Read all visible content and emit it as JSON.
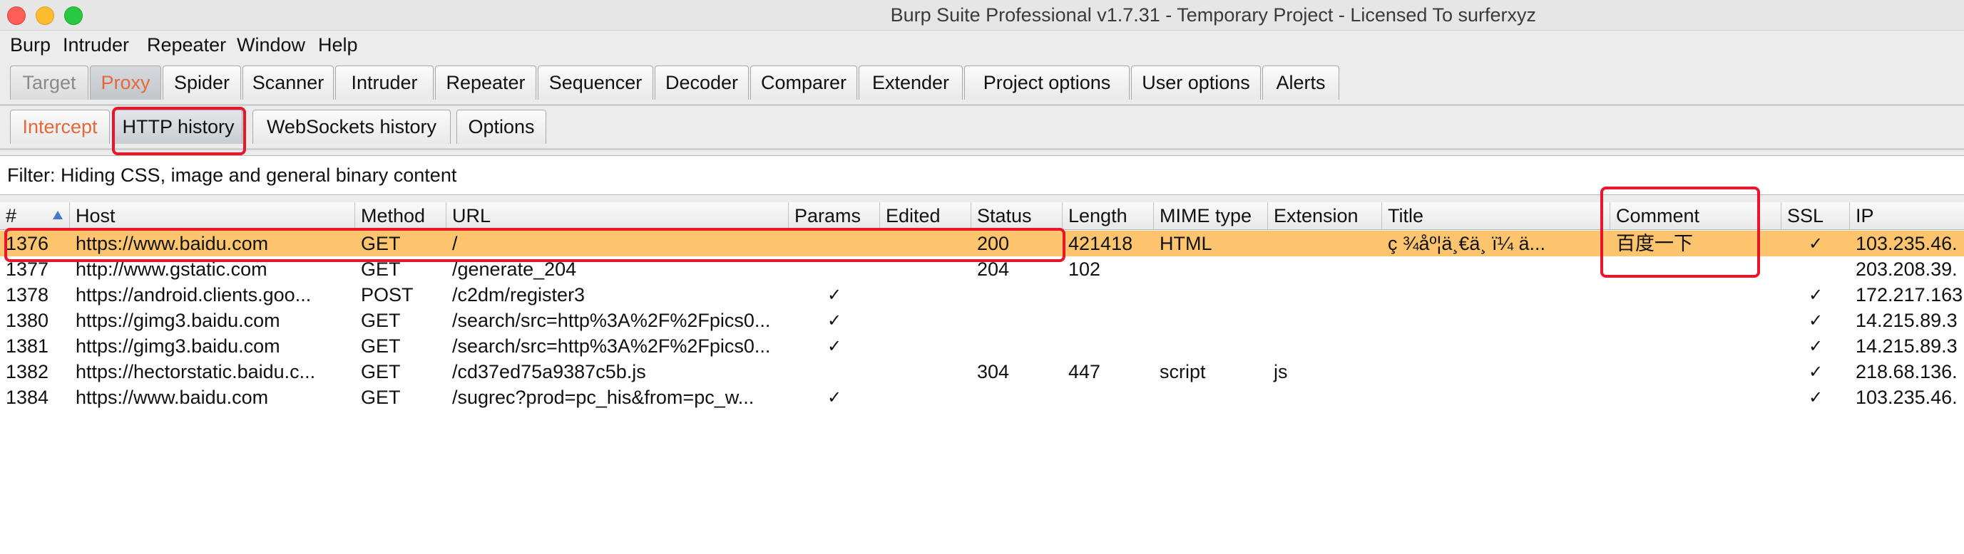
{
  "window": {
    "title": "Burp Suite Professional v1.7.31 - Temporary Project - Licensed To surferxyz"
  },
  "menu": [
    "Burp",
    "Intruder",
    "Repeater",
    "Window",
    "Help"
  ],
  "tabs": [
    "Target",
    "Proxy",
    "Spider",
    "Scanner",
    "Intruder",
    "Repeater",
    "Sequencer",
    "Decoder",
    "Comparer",
    "Extender",
    "Project options",
    "User options",
    "Alerts"
  ],
  "subtabs": [
    "Intercept",
    "HTTP history",
    "WebSockets history",
    "Options"
  ],
  "filter": {
    "text": "Filter: Hiding CSS, image and general binary content"
  },
  "table": {
    "columns": [
      "#",
      "Host",
      "Method",
      "URL",
      "Params",
      "Edited",
      "Status",
      "Length",
      "MIME type",
      "Extension",
      "Title",
      "Comment",
      "SSL",
      "IP"
    ],
    "check_mark": "✓",
    "rows": [
      {
        "id": "1376",
        "host": "https://www.baidu.com",
        "method": "GET",
        "url": "/",
        "params": "",
        "edited": "",
        "status": "200",
        "length": "421418",
        "mime": "HTML",
        "ext": "",
        "title": "ç   ¾åº¦ä¸€ä¸   ï¼    ä...",
        "comment": "百度一下",
        "ssl": "✓",
        "ip": "103.235.46.",
        "selected": true
      },
      {
        "id": "1377",
        "host": "http://www.gstatic.com",
        "method": "GET",
        "url": "/generate_204",
        "params": "",
        "edited": "",
        "status": "204",
        "length": "102",
        "mime": "",
        "ext": "",
        "title": "",
        "comment": "",
        "ssl": "",
        "ip": "203.208.39."
      },
      {
        "id": "1378",
        "host": "https://android.clients.goo...",
        "method": "POST",
        "url": "/c2dm/register3",
        "params": "✓",
        "edited": "",
        "status": "",
        "length": "",
        "mime": "",
        "ext": "",
        "title": "",
        "comment": "",
        "ssl": "✓",
        "ip": "172.217.163"
      },
      {
        "id": "1380",
        "host": "https://gimg3.baidu.com",
        "method": "GET",
        "url": "/search/src=http%3A%2F%2Fpics0...",
        "params": "✓",
        "edited": "",
        "status": "",
        "length": "",
        "mime": "",
        "ext": "",
        "title": "",
        "comment": "",
        "ssl": "✓",
        "ip": "14.215.89.3"
      },
      {
        "id": "1381",
        "host": "https://gimg3.baidu.com",
        "method": "GET",
        "url": "/search/src=http%3A%2F%2Fpics0...",
        "params": "✓",
        "edited": "",
        "status": "",
        "length": "",
        "mime": "",
        "ext": "",
        "title": "",
        "comment": "",
        "ssl": "✓",
        "ip": "14.215.89.3"
      },
      {
        "id": "1382",
        "host": "https://hectorstatic.baidu.c...",
        "method": "GET",
        "url": "/cd37ed75a9387c5b.js",
        "params": "",
        "edited": "",
        "status": "304",
        "length": "447",
        "mime": "script",
        "ext": "js",
        "title": "",
        "comment": "",
        "ssl": "✓",
        "ip": "218.68.136."
      },
      {
        "id": "1384",
        "host": "https://www.baidu.com",
        "method": "GET",
        "url": "/sugrec?prod=pc_his&from=pc_w...",
        "params": "✓",
        "edited": "",
        "status": "",
        "length": "",
        "mime": "",
        "ext": "",
        "title": "",
        "comment": "",
        "ssl": "✓",
        "ip": "103.235.46."
      }
    ]
  },
  "colors": {
    "selected_row": "#ffc56e",
    "active_tab_text": "#e2693a",
    "highlight_box": "#e8152b"
  }
}
